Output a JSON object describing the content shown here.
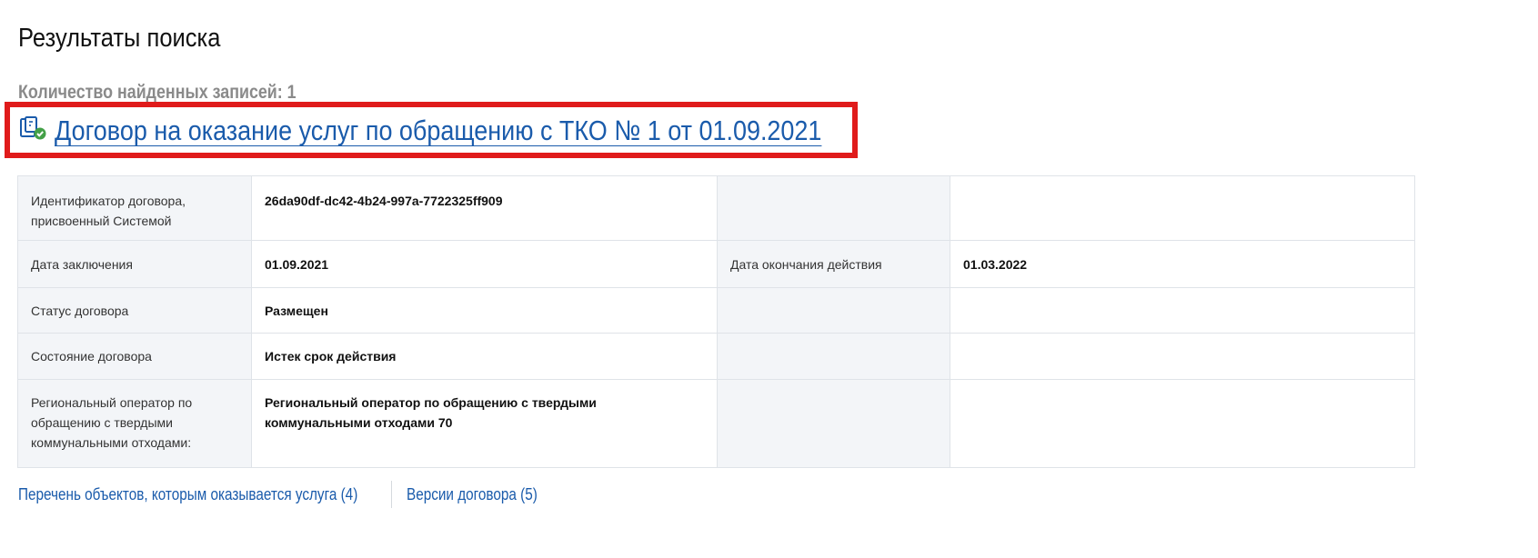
{
  "page": {
    "title": "Результаты поиска",
    "count_text": "Количество найденных записей: 1",
    "accent_color": "#1a5bab",
    "highlight_color": "#e01b1b"
  },
  "contract": {
    "icon": "document-check-icon",
    "title": "Договор на оказание услуг по обращению с ТКО № 1 от 01.09.2021"
  },
  "details": {
    "rows": [
      {
        "label": "Идентификатор договора, присвоенный Системой",
        "value": "26da90df-dc42-4b24-997a-7722325ff909",
        "label2": "",
        "value2": ""
      },
      {
        "label": "Дата заключения",
        "value": "01.09.2021",
        "label2": "Дата окончания действия",
        "value2": "01.03.2022"
      },
      {
        "label": "Статус договора",
        "value": "Размещен",
        "label2": "",
        "value2": ""
      },
      {
        "label": "Состояние договора",
        "value": "Истек срок действия",
        "label2": "",
        "value2": ""
      },
      {
        "label": "Региональный оператор по обращению с твердыми коммунальными отходами:",
        "value": "Региональный оператор по обращению с твердыми коммунальными отходами 70",
        "label2": "",
        "value2": ""
      }
    ]
  },
  "tabs": [
    {
      "label": "Перечень объектов, которым оказывается услуга (4)"
    },
    {
      "label": "Версии договора (5)"
    }
  ]
}
